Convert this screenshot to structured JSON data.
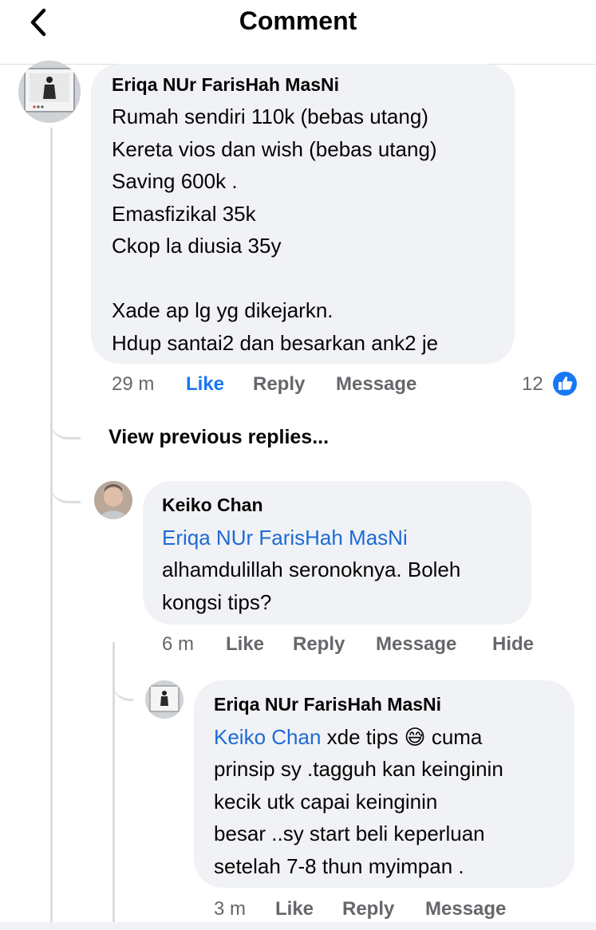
{
  "header": {
    "title": "Comment"
  },
  "comments": [
    {
      "author": "Eriqa NUr FarisHah MasNi",
      "text": "Rumah sendiri 110k (bebas utang)\nKereta vios dan wish (bebas utang)\nSaving 600k .\nEmasfizikal 35k\nCkop la diusia 35y\n\nXade ap lg yg dikejarkn.\nHdup santai2 dan besarkan ank2 je",
      "time": "29 m",
      "like": "Like",
      "reply": "Reply",
      "message": "Message",
      "reactions": "12",
      "reaction_color": "#1877f2"
    }
  ],
  "view_previous": "View previous replies...",
  "replies": [
    {
      "author": "Keiko Chan",
      "mention": "Eriqa NUr FarisHah MasNi",
      "text": "alhamdulillah seronoknya. Boleh\nkongsi tips?",
      "time": "6 m",
      "like": "Like",
      "reply": "Reply",
      "message": "Message",
      "hide": "Hide"
    },
    {
      "author": "Eriqa NUr FarisHah MasNi",
      "mention": "Keiko Chan",
      "text_after_mention": " xde tips ",
      "emoji": "😅",
      "text_line1_tail": " cuma",
      "text_rest": "prinsip sy .tagguh kan keinginin\nkecik utk capai keinginin\nbesar ..sy start beli keperluan\nsetelah 7-8 thun myimpan .",
      "time": "3 m",
      "like": "Like",
      "reply": "Reply",
      "message": "Message"
    }
  ],
  "colors": {
    "accent": "#1877f2",
    "mention": "#1d6ad6",
    "bubble": "#f0f2f5",
    "muted": "#65676b"
  }
}
